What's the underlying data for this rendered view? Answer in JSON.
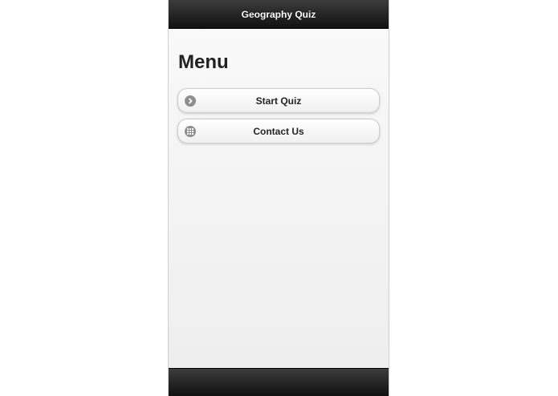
{
  "header": {
    "title": "Geography Quiz"
  },
  "page": {
    "title": "Menu"
  },
  "menu": [
    {
      "label": "Start Quiz",
      "icon": "arrow-right-circle-icon"
    },
    {
      "label": "Contact Us",
      "icon": "grid-icon"
    }
  ]
}
